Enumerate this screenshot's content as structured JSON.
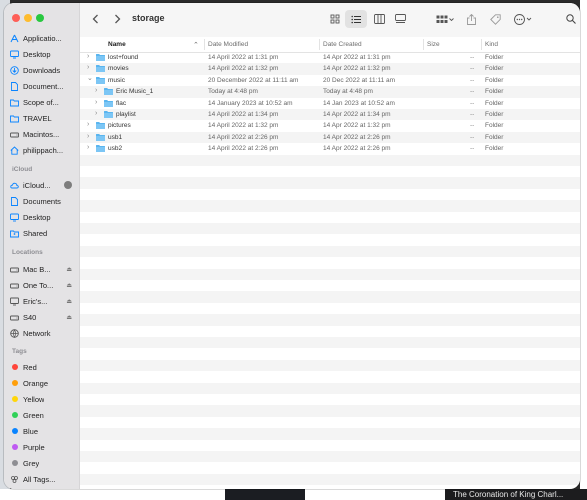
{
  "window": {
    "title": "storage"
  },
  "sidebar": {
    "favorites": [
      {
        "label": "Applicatio...",
        "icon": "applications-icon"
      },
      {
        "label": "Desktop",
        "icon": "desktop-icon"
      },
      {
        "label": "Downloads",
        "icon": "downloads-icon"
      },
      {
        "label": "Document...",
        "icon": "documents-icon"
      },
      {
        "label": "Scope of...",
        "icon": "folder-icon"
      },
      {
        "label": "TRAVEL",
        "icon": "folder-icon"
      },
      {
        "label": "Macintos...",
        "icon": "drive-icon"
      },
      {
        "label": "philippach...",
        "icon": "home-icon"
      }
    ],
    "icloud_heading": "iCloud",
    "icloud": [
      {
        "label": "iCloud...",
        "icon": "icloud-icon"
      },
      {
        "label": "Documents",
        "icon": "documents-icon"
      },
      {
        "label": "Desktop",
        "icon": "desktop-icon"
      },
      {
        "label": "Shared",
        "icon": "shared-folder-icon"
      }
    ],
    "locations_heading": "Locations",
    "locations": [
      {
        "label": "Mac B...",
        "icon": "drive-icon"
      },
      {
        "label": "One To...",
        "icon": "drive-icon"
      },
      {
        "label": "Eric's...",
        "icon": "display-icon"
      },
      {
        "label": "S40",
        "icon": "drive-icon"
      },
      {
        "label": "Network",
        "icon": "network-icon"
      }
    ],
    "tags_heading": "Tags",
    "tags": [
      {
        "label": "Red",
        "color": "#ff453a"
      },
      {
        "label": "Orange",
        "color": "#ff9f0a"
      },
      {
        "label": "Yellow",
        "color": "#ffd60a"
      },
      {
        "label": "Green",
        "color": "#30d158"
      },
      {
        "label": "Blue",
        "color": "#0a84ff"
      },
      {
        "label": "Purple",
        "color": "#bf5af2"
      },
      {
        "label": "Grey",
        "color": "#8e8e93"
      },
      {
        "label": "All Tags...",
        "color": ""
      }
    ]
  },
  "columns": {
    "name": "Name",
    "date_modified": "Date Modified",
    "date_created": "Date Created",
    "size": "Size",
    "kind": "Kind"
  },
  "files": [
    {
      "name": "lost+found",
      "modified": "14 April 2022 at 1:31 pm",
      "created": "14 Apr 2022 at 1:31 pm",
      "size": "--",
      "kind": "Folder",
      "depth": 0
    },
    {
      "name": "movies",
      "modified": "14 April 2022 at 1:32 pm",
      "created": "14 Apr 2022 at 1:32 pm",
      "size": "--",
      "kind": "Folder",
      "depth": 0
    },
    {
      "name": "music",
      "modified": "20 December 2022 at 11:11 am",
      "created": "20 Dec 2022 at 11:11 am",
      "size": "--",
      "kind": "Folder",
      "depth": 0,
      "expanded": true
    },
    {
      "name": "Eric Music_1",
      "modified": "Today at 4:48 pm",
      "created": "Today at 4:48 pm",
      "size": "--",
      "kind": "Folder",
      "depth": 1
    },
    {
      "name": "flac",
      "modified": "14 January 2023 at 10:52 am",
      "created": "14 Jan 2023 at 10:52 am",
      "size": "--",
      "kind": "Folder",
      "depth": 1
    },
    {
      "name": "playlist",
      "modified": "14 April 2022 at 1:34 pm",
      "created": "14 Apr 2022 at 1:34 pm",
      "size": "--",
      "kind": "Folder",
      "depth": 1
    },
    {
      "name": "pictures",
      "modified": "14 April 2022 at 1:32 pm",
      "created": "14 Apr 2022 at 1:32 pm",
      "size": "--",
      "kind": "Folder",
      "depth": 0
    },
    {
      "name": "usb1",
      "modified": "14 April 2022 at 2:26 pm",
      "created": "14 Apr 2022 at 2:26 pm",
      "size": "--",
      "kind": "Folder",
      "depth": 0
    },
    {
      "name": "usb2",
      "modified": "14 April 2022 at 2:26 pm",
      "created": "14 Apr 2022 at 2:26 pm",
      "size": "--",
      "kind": "Folder",
      "depth": 0
    }
  ],
  "background": {
    "news_text": "The Coronation of King Charl..."
  }
}
